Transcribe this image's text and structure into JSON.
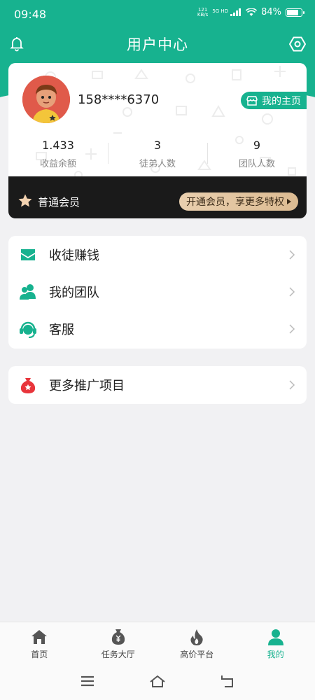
{
  "status_bar": {
    "time": "09:48",
    "net_speed_value": "121",
    "net_speed_unit": "KB/s",
    "signal": "5G HD",
    "battery": "84%"
  },
  "header": {
    "title": "用户中心"
  },
  "profile": {
    "phone": "158****6370",
    "homepage_label": "我的主页",
    "stats": [
      {
        "value": "1.433",
        "label": "收益余额"
      },
      {
        "value": "3",
        "label": "徒弟人数"
      },
      {
        "value": "9",
        "label": "团队人数"
      }
    ]
  },
  "membership": {
    "level": "普通会员",
    "cta": "开通会员，享更多特权"
  },
  "menu_main": [
    {
      "label": "收徒赚钱",
      "icon": "envelope-icon"
    },
    {
      "label": "我的团队",
      "icon": "team-icon"
    },
    {
      "label": "客服",
      "icon": "customer-service-icon"
    }
  ],
  "menu_more": [
    {
      "label": "更多推广项目",
      "icon": "money-bag-icon"
    }
  ],
  "bottom_nav": [
    {
      "label": "首页",
      "icon": "home-icon",
      "active": false
    },
    {
      "label": "任务大厅",
      "icon": "yuan-bag-icon",
      "active": false
    },
    {
      "label": "高价平台",
      "icon": "flame-icon",
      "active": false
    },
    {
      "label": "我的",
      "icon": "user-icon",
      "active": true
    }
  ],
  "colors": {
    "primary": "#17b28f",
    "member_bar": "#1a1a1a",
    "member_cta": "#e2c49f",
    "background": "#f1f1f3"
  }
}
